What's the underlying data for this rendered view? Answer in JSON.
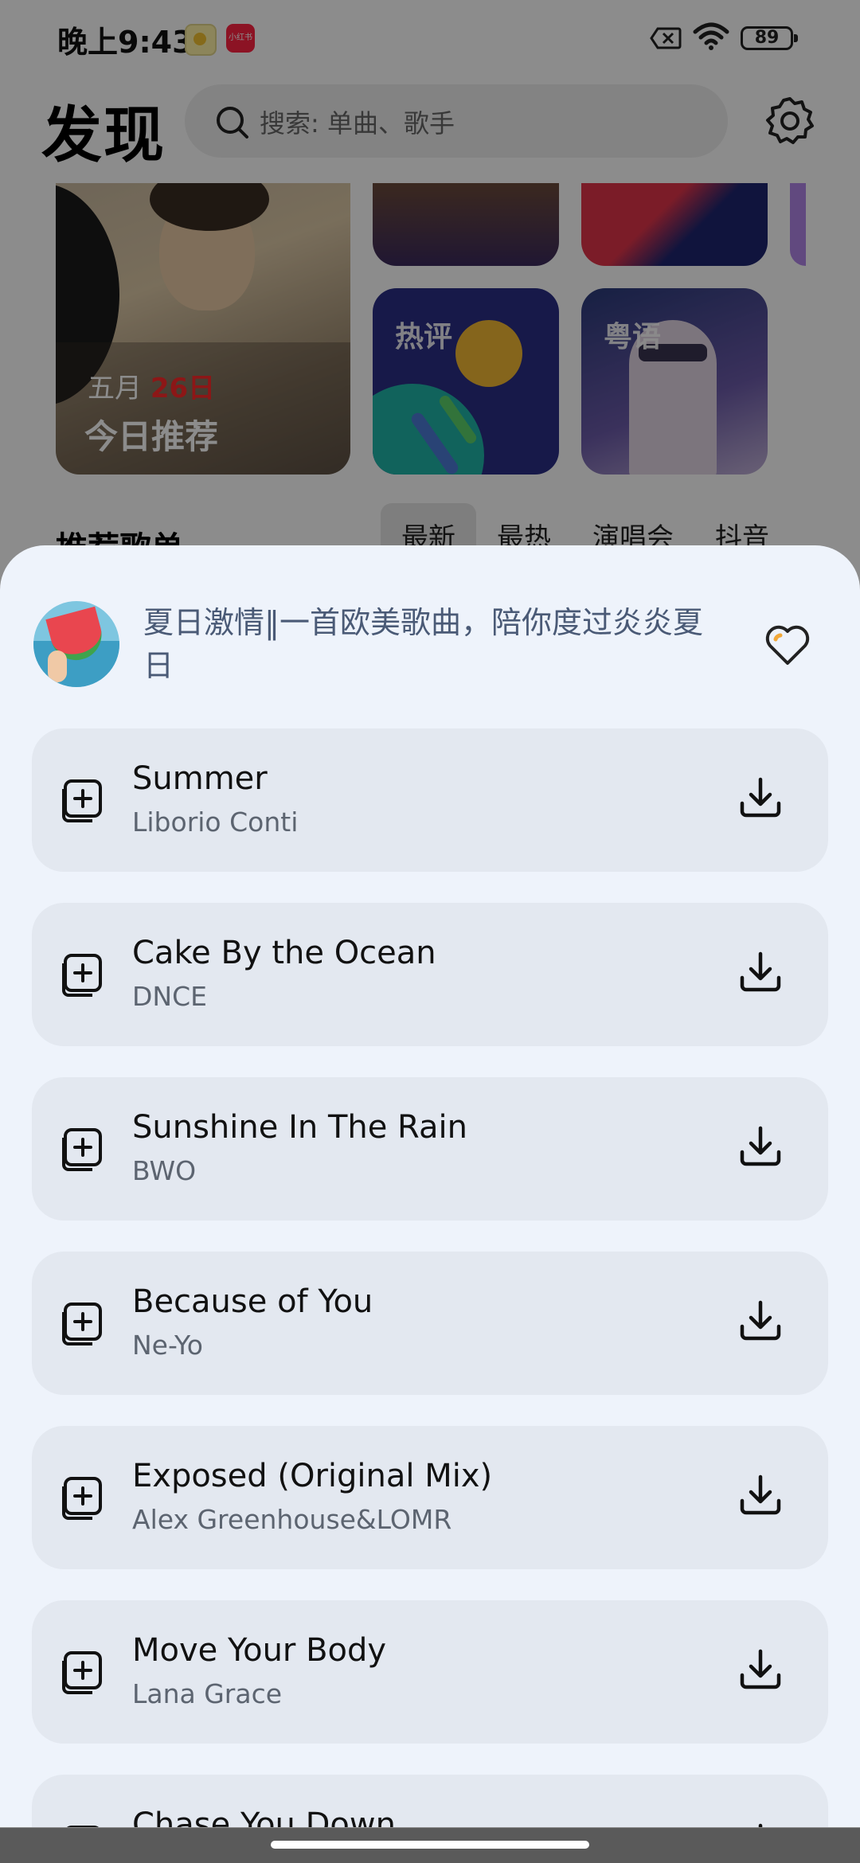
{
  "status_bar": {
    "time": "晚上9:43",
    "battery": "89",
    "mini_app_label": "小红书"
  },
  "header": {
    "title": "发现",
    "search_placeholder": "搜索: 单曲、歌手"
  },
  "daily_card": {
    "month": "五月",
    "day": "26日",
    "title": "今日推荐"
  },
  "tiles": [
    {
      "label": "热评"
    },
    {
      "label": "粤语"
    }
  ],
  "section": {
    "title": "推荐歌单",
    "tabs": [
      "最新",
      "最热",
      "演唱会",
      "抖音"
    ]
  },
  "playlist": {
    "title": "夏日激情‖一首欧美歌曲，陪你度过炎炎夏日"
  },
  "songs": [
    {
      "title": "Summer",
      "artist": "Liborio Conti"
    },
    {
      "title": "Cake By the Ocean",
      "artist": "DNCE"
    },
    {
      "title": "Sunshine In The Rain",
      "artist": "BWO"
    },
    {
      "title": "Because of You",
      "artist": "Ne-Yo"
    },
    {
      "title": "Exposed (Original Mix)",
      "artist": "Alex Greenhouse&LOMR"
    },
    {
      "title": "Move Your Body",
      "artist": "Lana Grace"
    },
    {
      "title": "Chase You Down",
      "artist": ""
    }
  ],
  "colors": {
    "sheet_bg": "#eef3fb",
    "song_row_bg": "#e3e8f0",
    "accent_date": "#ff2a2a"
  },
  "icons": [
    "search-icon",
    "settings-icon",
    "heart-icon",
    "add-to-playlist-icon",
    "download-icon",
    "wifi-icon",
    "sim-icon"
  ]
}
